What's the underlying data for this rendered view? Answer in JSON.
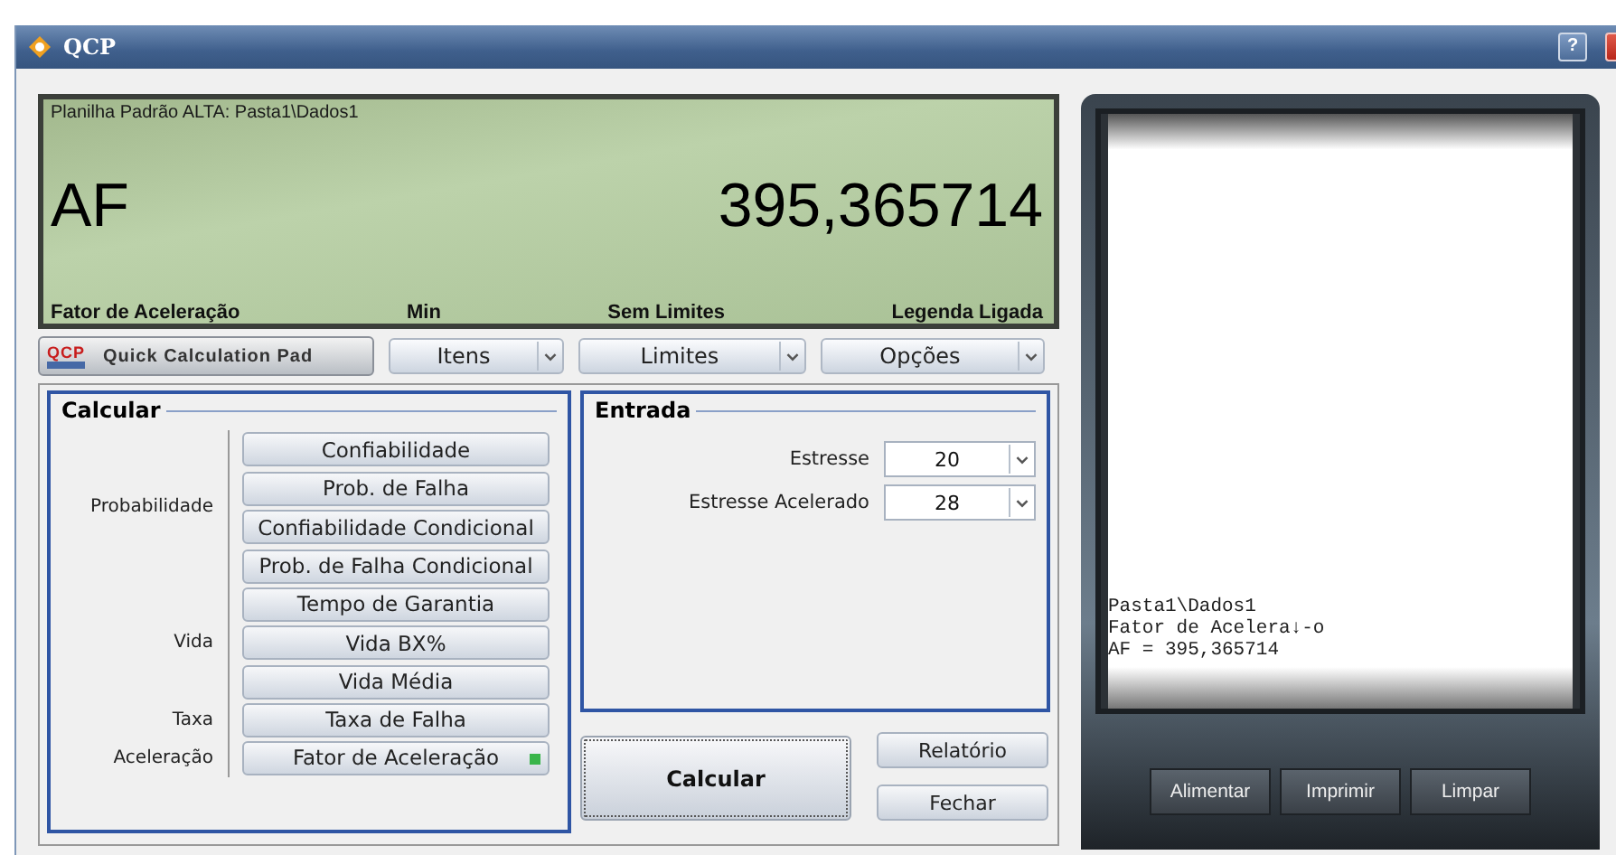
{
  "window": {
    "title": "QCP",
    "help": "?"
  },
  "display": {
    "caption": "Planilha Padrão ALTA: Pasta1\\Dados1",
    "symbol": "AF",
    "value": "395,365714",
    "footer": [
      "Fator de Aceleração",
      "Min",
      "Sem Limites",
      "Legenda Ligada"
    ]
  },
  "toolbar": {
    "logo_text": "QCP",
    "pad_label": "Quick Calculation Pad",
    "dropdowns": [
      "Itens",
      "Limites",
      "Opções"
    ]
  },
  "calcular": {
    "title": "Calcular",
    "groups": [
      {
        "label": "Probabilidade",
        "buttons": [
          {
            "label": "Confiabilidade",
            "selected": false
          },
          {
            "label": "Prob. de Falha",
            "selected": false
          },
          {
            "label": "Confiabilidade Condicional",
            "selected": false
          },
          {
            "label": "Prob. de Falha Condicional",
            "selected": false
          }
        ]
      },
      {
        "label": "Vida",
        "buttons": [
          {
            "label": "Tempo de Garantia",
            "selected": false
          },
          {
            "label": "Vida BX%",
            "selected": false
          },
          {
            "label": "Vida Média",
            "selected": false
          }
        ]
      },
      {
        "label": "Taxa",
        "buttons": [
          {
            "label": "Taxa de Falha",
            "selected": false
          }
        ]
      },
      {
        "label": "Aceleração",
        "buttons": [
          {
            "label": "Fator de Aceleração",
            "selected": true
          }
        ]
      }
    ]
  },
  "entrada": {
    "title": "Entrada",
    "fields": [
      {
        "label": "Estresse",
        "value": "20"
      },
      {
        "label": "Estresse Acelerado",
        "value": "28"
      }
    ]
  },
  "actions": {
    "calculate": "Calcular",
    "side": [
      "Relatório",
      "Fechar"
    ]
  },
  "printer": {
    "lines": [
      "Pasta1\\Dados1",
      "Fator de Acelera↓-o",
      "AF = 395,365714"
    ],
    "buttons": [
      "Alimentar",
      "Imprimir",
      "Limpar"
    ]
  }
}
